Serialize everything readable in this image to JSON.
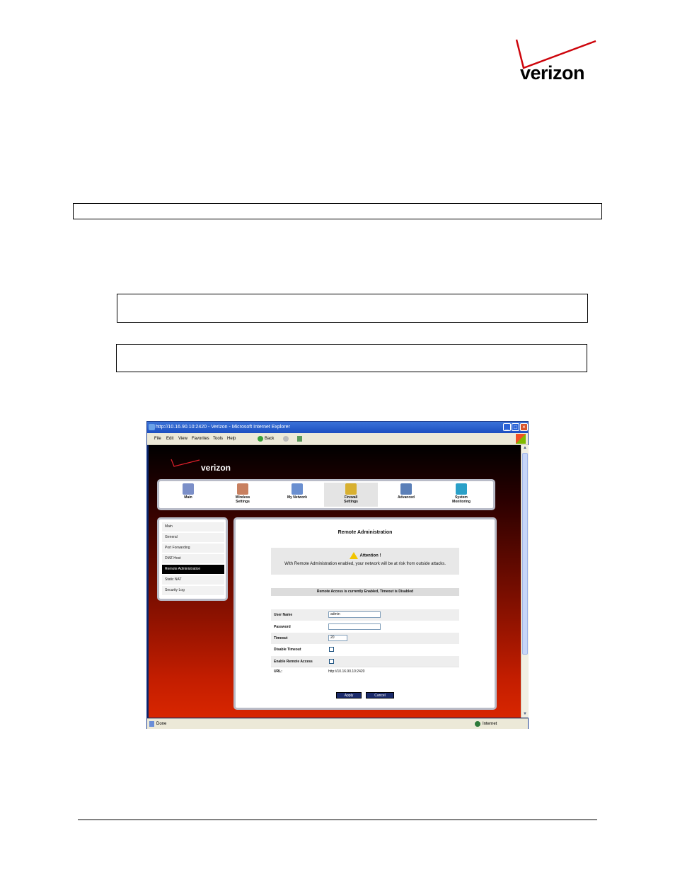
{
  "header": {
    "logo_text": "verizon"
  },
  "browser": {
    "title": "http://10.16.90.10:2420 - Verizon - Microsoft Internet Explorer",
    "menu": [
      "File",
      "Edit",
      "View",
      "Favorites",
      "Tools",
      "Help"
    ],
    "back_label": "Back",
    "status_left": "Done",
    "status_right": "Internet"
  },
  "router": {
    "logo_text": "verizon",
    "nav": [
      {
        "label": "Main",
        "icon": "main-icon",
        "color": "#7b8fc8"
      },
      {
        "label": "Wireless\nSettings",
        "icon": "wireless-icon",
        "color": "#c88060"
      },
      {
        "label": "My Network",
        "icon": "network-icon",
        "color": "#6a8fd0"
      },
      {
        "label": "Firewall\nSettings",
        "icon": "firewall-icon",
        "color": "#d8b030"
      },
      {
        "label": "Advanced",
        "icon": "advanced-icon",
        "color": "#5a7fb8"
      },
      {
        "label": "System\nMonitoring",
        "icon": "monitor-icon",
        "color": "#2aa0c8"
      }
    ],
    "active_nav": "Firewall\nSettings",
    "side_items": [
      "Main",
      "General",
      "Port Forwarding",
      "DMZ Host",
      "Remote Administration",
      "Static NAT",
      "Security Log"
    ],
    "active_side": "Remote Administration",
    "panel": {
      "title": "Remote Administration",
      "attention_head": "Attention !",
      "attention_body": "With Remote Administration enabled, your network will be at risk from outside attacks.",
      "status": "Remote Access is currently Enabled, Timeout is Disabled",
      "fields": {
        "user_name_label": "User Name",
        "user_name_value": "admin",
        "password_label": "Password",
        "timeout_label": "Timeout",
        "timeout_value": "20",
        "disable_timeout_label": "Disable Timeout",
        "enable_remote_label": "Enable Remote Access",
        "url_label": "URL:",
        "url_value": "http://10.16.90.10:2420"
      },
      "apply_label": "Apply",
      "cancel_label": "Cancel"
    }
  }
}
